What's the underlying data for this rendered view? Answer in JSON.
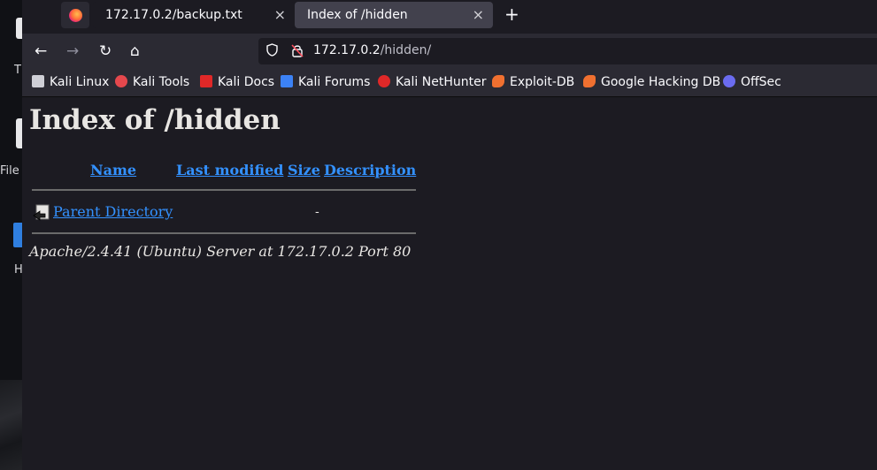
{
  "desktop": {
    "icons": [
      {
        "name": "trash",
        "label": "T"
      },
      {
        "name": "file-system",
        "label": "File"
      },
      {
        "name": "home",
        "label": "H"
      }
    ]
  },
  "tabs": [
    {
      "label": "172.17.0.2/backup.txt",
      "active": false
    },
    {
      "label": "Index of /hidden",
      "active": true
    }
  ],
  "tab_icons": {
    "close": "×",
    "new": "+"
  },
  "nav": {
    "back": "←",
    "forward": "→",
    "reload": "↻",
    "home": "⌂",
    "url_host": "172.17.0.2",
    "url_path": "/hidden/"
  },
  "bookmarks": [
    {
      "label": "Kali Linux",
      "color": "#cfcfd6"
    },
    {
      "label": "Kali Tools",
      "color": "#e5484d"
    },
    {
      "label": "Kali Docs",
      "color": "#e02828"
    },
    {
      "label": "Kali Forums",
      "color": "#3c82f6"
    },
    {
      "label": "Kali NetHunter",
      "color": "#e02828"
    },
    {
      "label": "Exploit-DB",
      "color": "#f07030"
    },
    {
      "label": "Google Hacking DB",
      "color": "#f07030"
    },
    {
      "label": "OffSec",
      "color": "#6b6cf0"
    }
  ],
  "page": {
    "title": "Index of /hidden",
    "columns": [
      "Name",
      "Last modified",
      "Size",
      "Description"
    ],
    "parent": {
      "name": "Parent Directory",
      "size": "-"
    },
    "signature": "Apache/2.4.41 (Ubuntu) Server at 172.17.0.2 Port 80"
  },
  "colors": {
    "link": "#3391ff",
    "text": "#e8e6e3",
    "background": "#1c1b22"
  }
}
